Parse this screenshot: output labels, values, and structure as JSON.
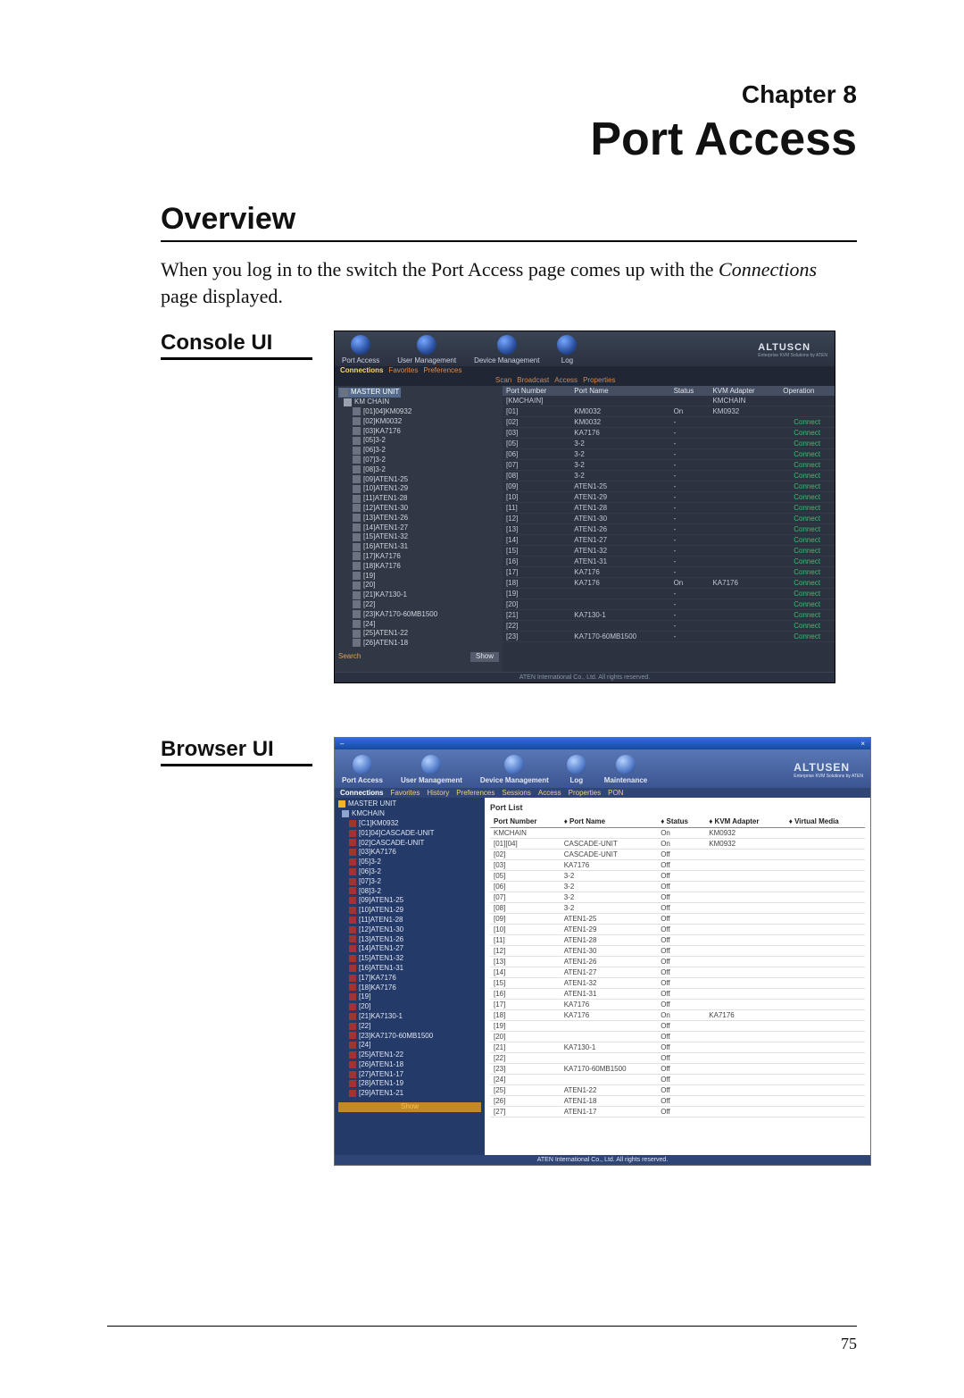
{
  "doc": {
    "chapter": "Chapter 8",
    "title": "Port Access",
    "overview_heading": "Overview",
    "body_prefix": "When you log in to the switch the Port Access page comes up with the ",
    "body_italic": "Connections",
    "body_suffix": " page displayed.",
    "console_label": "Console UI",
    "browser_label": "Browser UI",
    "page_number": "75"
  },
  "console": {
    "brand": "ALTUSCN",
    "brand_sub": "Enterprise KVM Solutions by ATEN",
    "top_buttons": [
      "Port Access",
      "User Management",
      "Device Management",
      "Log"
    ],
    "subtabs_left": [
      "Connections",
      "Favorites",
      "Preferences"
    ],
    "subtabs_right": [
      "Scan",
      "Broadcast",
      "Access",
      "Properties"
    ],
    "tree_root": "MASTER UNIT",
    "tree": [
      "KM CHAIN",
      "[01]04]KM0932",
      "[02]KM0032",
      "[03]KA7176",
      "[05]3-2",
      "[06]3-2",
      "[07]3-2",
      "[08]3-2",
      "[09]ATEN1-25",
      "[10]ATEN1-29",
      "[11]ATEN1-28",
      "[12]ATEN1-30",
      "[13]ATEN1-26",
      "[14]ATEN1-27",
      "[15]ATEN1-32",
      "[16]ATEN1-31",
      "[17]KA7176",
      "[18]KA7176",
      "[19]",
      "[20]",
      "[21]KA7130-1",
      "[22]",
      "[23]KA7170-60MB1500",
      "[24]",
      "[25]ATEN1-22",
      "[26]ATEN1-18"
    ],
    "search_label": "Search",
    "search_button": "Show",
    "table_headers": [
      "Port Number",
      "Port Name",
      "Status",
      "KVM Adapter",
      "Operation"
    ],
    "table_first_row": [
      "[KMCHAIN]",
      "",
      "",
      "KMCHAIN",
      ""
    ],
    "rows": [
      {
        "num": "[01]",
        "name": "KM0032",
        "status": "On",
        "adapter": "KM0932",
        "op": ""
      },
      {
        "num": "[02]",
        "name": "KM0032",
        "status": "-",
        "adapter": "",
        "op": "Connect"
      },
      {
        "num": "[03]",
        "name": "KA7176",
        "status": "-",
        "adapter": "",
        "op": "Connect"
      },
      {
        "num": "[05]",
        "name": "3-2",
        "status": "-",
        "adapter": "",
        "op": "Connect"
      },
      {
        "num": "[06]",
        "name": "3-2",
        "status": "-",
        "adapter": "",
        "op": "Connect"
      },
      {
        "num": "[07]",
        "name": "3-2",
        "status": "-",
        "adapter": "",
        "op": "Connect"
      },
      {
        "num": "[08]",
        "name": "3-2",
        "status": "-",
        "adapter": "",
        "op": "Connect"
      },
      {
        "num": "[09]",
        "name": "ATEN1-25",
        "status": "-",
        "adapter": "",
        "op": "Connect"
      },
      {
        "num": "[10]",
        "name": "ATEN1-29",
        "status": "-",
        "adapter": "",
        "op": "Connect"
      },
      {
        "num": "[11]",
        "name": "ATEN1-28",
        "status": "-",
        "adapter": "",
        "op": "Connect"
      },
      {
        "num": "[12]",
        "name": "ATEN1-30",
        "status": "-",
        "adapter": "",
        "op": "Connect"
      },
      {
        "num": "[13]",
        "name": "ATEN1-26",
        "status": "-",
        "adapter": "",
        "op": "Connect"
      },
      {
        "num": "[14]",
        "name": "ATEN1-27",
        "status": "-",
        "adapter": "",
        "op": "Connect"
      },
      {
        "num": "[15]",
        "name": "ATEN1-32",
        "status": "-",
        "adapter": "",
        "op": "Connect"
      },
      {
        "num": "[16]",
        "name": "ATEN1-31",
        "status": "-",
        "adapter": "",
        "op": "Connect"
      },
      {
        "num": "[17]",
        "name": "KA7176",
        "status": "-",
        "adapter": "",
        "op": "Connect"
      },
      {
        "num": "[18]",
        "name": "KA7176",
        "status": "On",
        "adapter": "KA7176",
        "op": "Connect"
      },
      {
        "num": "[19]",
        "name": "",
        "status": "-",
        "adapter": "",
        "op": "Connect"
      },
      {
        "num": "[20]",
        "name": "",
        "status": "-",
        "adapter": "",
        "op": "Connect"
      },
      {
        "num": "[21]",
        "name": "KA7130-1",
        "status": "-",
        "adapter": "",
        "op": "Connect"
      },
      {
        "num": "[22]",
        "name": "",
        "status": "-",
        "adapter": "",
        "op": "Connect"
      },
      {
        "num": "[23]",
        "name": "KA7170-60MB1500",
        "status": "-",
        "adapter": "",
        "op": "Connect"
      }
    ],
    "footer": "ATEN International Co., Ltd. All rights reserved."
  },
  "browser": {
    "brand": "ALTUSEN",
    "brand_sub": "Enterprise KVM Solutions by ATEN",
    "top_buttons": [
      "Port Access",
      "User Management",
      "Device Management",
      "Log",
      "Maintenance"
    ],
    "subtabs": [
      "Connections",
      "Favorites",
      "History",
      "Preferences",
      "Sessions",
      "Access",
      "Properties",
      "PON"
    ],
    "section_label": "Port List",
    "tree_root": "MASTER UNIT",
    "tree": [
      "KMCHAIN",
      "[C1]KM0932",
      "[01]04]CASCADE-UNIT",
      "[02]CASCADE-UNIT",
      "[03]KA7176",
      "[05]3-2",
      "[06]3-2",
      "[07]3-2",
      "[08]3-2",
      "[09]ATEN1-25",
      "[10]ATEN1-29",
      "[11]ATEN1-28",
      "[12]ATEN1-30",
      "[13]ATEN1-26",
      "[14]ATEN1-27",
      "[15]ATEN1-32",
      "[16]ATEN1-31",
      "[17]KA7176",
      "[18]KA7176",
      "[19]",
      "[20]",
      "[21]KA7130-1",
      "[22]",
      "[23]KA7170-60MB1500",
      "[24]",
      "[25]ATEN1-22",
      "[26]ATEN1-18",
      "[27]ATEN1-17",
      "[28]ATEN1-19",
      "[29]ATEN1-21"
    ],
    "show_label": "Show",
    "table_headers": [
      "Port Number",
      "Port Name",
      "Status",
      "KVM Adapter",
      "Virtual Media"
    ],
    "table_first_row": [
      "KMCHAIN",
      "",
      "On",
      "KM0932",
      ""
    ],
    "rows": [
      {
        "num": "[01][04]",
        "name": "CASCADE-UNIT",
        "status": "On",
        "adapter": "KM0932",
        "vm": ""
      },
      {
        "num": "[02]",
        "name": "CASCADE-UNIT",
        "status": "Off",
        "adapter": "",
        "vm": ""
      },
      {
        "num": "[03]",
        "name": "KA7176",
        "status": "Off",
        "adapter": "",
        "vm": ""
      },
      {
        "num": "[05]",
        "name": "3-2",
        "status": "Off",
        "adapter": "",
        "vm": ""
      },
      {
        "num": "[06]",
        "name": "3-2",
        "status": "Off",
        "adapter": "",
        "vm": ""
      },
      {
        "num": "[07]",
        "name": "3-2",
        "status": "Off",
        "adapter": "",
        "vm": ""
      },
      {
        "num": "[08]",
        "name": "3-2",
        "status": "Off",
        "adapter": "",
        "vm": ""
      },
      {
        "num": "[09]",
        "name": "ATEN1-25",
        "status": "Off",
        "adapter": "",
        "vm": ""
      },
      {
        "num": "[10]",
        "name": "ATEN1-29",
        "status": "Off",
        "adapter": "",
        "vm": ""
      },
      {
        "num": "[11]",
        "name": "ATEN1-28",
        "status": "Off",
        "adapter": "",
        "vm": ""
      },
      {
        "num": "[12]",
        "name": "ATEN1-30",
        "status": "Off",
        "adapter": "",
        "vm": ""
      },
      {
        "num": "[13]",
        "name": "ATEN1-26",
        "status": "Off",
        "adapter": "",
        "vm": ""
      },
      {
        "num": "[14]",
        "name": "ATEN1-27",
        "status": "Off",
        "adapter": "",
        "vm": ""
      },
      {
        "num": "[15]",
        "name": "ATEN1-32",
        "status": "Off",
        "adapter": "",
        "vm": ""
      },
      {
        "num": "[16]",
        "name": "ATEN1-31",
        "status": "Off",
        "adapter": "",
        "vm": ""
      },
      {
        "num": "[17]",
        "name": "KA7176",
        "status": "Off",
        "adapter": "",
        "vm": ""
      },
      {
        "num": "[18]",
        "name": "KA7176",
        "status": "On",
        "adapter": "KA7176",
        "vm": ""
      },
      {
        "num": "[19]",
        "name": "",
        "status": "Off",
        "adapter": "",
        "vm": ""
      },
      {
        "num": "[20]",
        "name": "",
        "status": "Off",
        "adapter": "",
        "vm": ""
      },
      {
        "num": "[21]",
        "name": "KA7130-1",
        "status": "Off",
        "adapter": "",
        "vm": ""
      },
      {
        "num": "[22]",
        "name": "",
        "status": "Off",
        "adapter": "",
        "vm": ""
      },
      {
        "num": "[23]",
        "name": "KA7170-60MB1500",
        "status": "Off",
        "adapter": "",
        "vm": ""
      },
      {
        "num": "[24]",
        "name": "",
        "status": "Off",
        "adapter": "",
        "vm": ""
      },
      {
        "num": "[25]",
        "name": "ATEN1-22",
        "status": "Off",
        "adapter": "",
        "vm": ""
      },
      {
        "num": "[26]",
        "name": "ATEN1-18",
        "status": "Off",
        "adapter": "",
        "vm": ""
      },
      {
        "num": "[27]",
        "name": "ATEN1-17",
        "status": "Off",
        "adapter": "",
        "vm": ""
      }
    ],
    "footer": "ATEN International Co., Ltd. All rights reserved."
  }
}
